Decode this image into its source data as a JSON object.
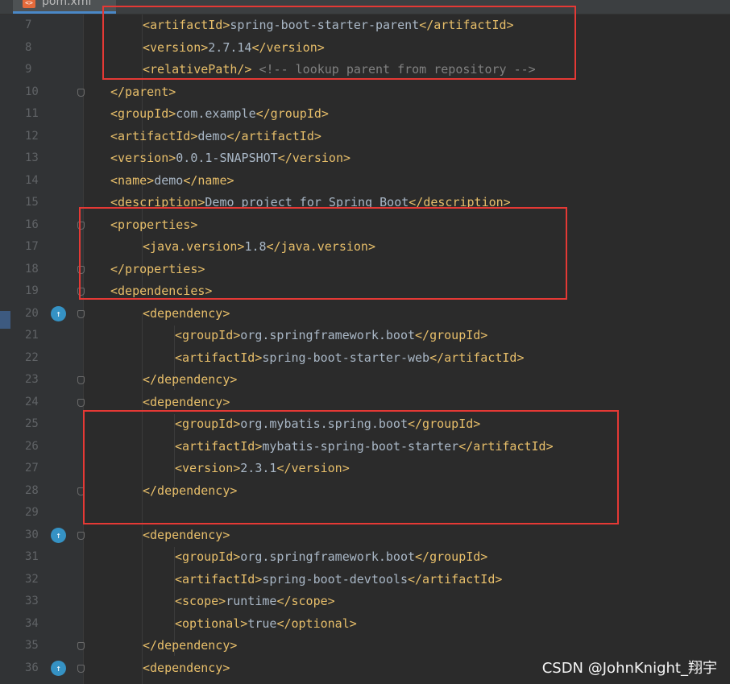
{
  "tab": {
    "filename": "pom.xml",
    "icon": "xml-file-icon"
  },
  "watermark": "CSDN @JohnKnight_翔宇",
  "colors": {
    "tag": "#e8bf6a",
    "text": "#a9b7c6",
    "comment": "#808080",
    "highlight": "#e53935",
    "run_icon": "#3592c4"
  },
  "lines": [
    {
      "num": "7",
      "indent": 2,
      "parts": [
        [
          "tag",
          "<artifactId>"
        ],
        [
          "text",
          "spring-boot-starter-parent"
        ],
        [
          "tag",
          "</artifactId>"
        ]
      ]
    },
    {
      "num": "8",
      "indent": 2,
      "parts": [
        [
          "tag",
          "<version>"
        ],
        [
          "text",
          "2.7.14"
        ],
        [
          "tag",
          "</version>"
        ]
      ]
    },
    {
      "num": "9",
      "indent": 2,
      "parts": [
        [
          "tag",
          "<relativePath/>"
        ],
        [
          "text",
          " "
        ],
        [
          "comment",
          "<!-- lookup parent from repository -->"
        ]
      ]
    },
    {
      "num": "10",
      "indent": 1,
      "parts": [
        [
          "tag",
          "</parent>"
        ]
      ]
    },
    {
      "num": "11",
      "indent": 1,
      "parts": [
        [
          "tag",
          "<groupId>"
        ],
        [
          "text",
          "com.example"
        ],
        [
          "tag",
          "</groupId>"
        ]
      ]
    },
    {
      "num": "12",
      "indent": 1,
      "parts": [
        [
          "tag",
          "<artifactId>"
        ],
        [
          "text",
          "demo"
        ],
        [
          "tag",
          "</artifactId>"
        ]
      ]
    },
    {
      "num": "13",
      "indent": 1,
      "parts": [
        [
          "tag",
          "<version>"
        ],
        [
          "text",
          "0.0.1-SNAPSHOT"
        ],
        [
          "tag",
          "</version>"
        ]
      ]
    },
    {
      "num": "14",
      "indent": 1,
      "parts": [
        [
          "tag",
          "<name>"
        ],
        [
          "text",
          "demo"
        ],
        [
          "tag",
          "</name>"
        ]
      ]
    },
    {
      "num": "15",
      "indent": 1,
      "parts": [
        [
          "tag",
          "<description>"
        ],
        [
          "text",
          "Demo project for Spring Boot"
        ],
        [
          "tag",
          "</description>"
        ]
      ]
    },
    {
      "num": "16",
      "indent": 1,
      "parts": [
        [
          "tag",
          "<properties>"
        ]
      ]
    },
    {
      "num": "17",
      "indent": 2,
      "parts": [
        [
          "tag",
          "<java.version>"
        ],
        [
          "text",
          "1.8"
        ],
        [
          "tag",
          "</java.version>"
        ]
      ]
    },
    {
      "num": "18",
      "indent": 1,
      "parts": [
        [
          "tag",
          "</properties>"
        ]
      ]
    },
    {
      "num": "19",
      "indent": 1,
      "parts": [
        [
          "tag",
          "<dependencies>"
        ]
      ]
    },
    {
      "num": "20",
      "indent": 2,
      "parts": [
        [
          "tag",
          "<dependency>"
        ]
      ]
    },
    {
      "num": "21",
      "indent": 3,
      "parts": [
        [
          "tag",
          "<groupId>"
        ],
        [
          "text",
          "org.springframework.boot"
        ],
        [
          "tag",
          "</groupId>"
        ]
      ]
    },
    {
      "num": "22",
      "indent": 3,
      "parts": [
        [
          "tag",
          "<artifactId>"
        ],
        [
          "text",
          "spring-boot-starter-web"
        ],
        [
          "tag",
          "</artifactId>"
        ]
      ]
    },
    {
      "num": "23",
      "indent": 2,
      "parts": [
        [
          "tag",
          "</dependency>"
        ]
      ]
    },
    {
      "num": "24",
      "indent": 2,
      "parts": [
        [
          "tag",
          "<dependency>"
        ]
      ]
    },
    {
      "num": "25",
      "indent": 3,
      "parts": [
        [
          "tag",
          "<groupId>"
        ],
        [
          "text",
          "org.mybatis.spring.boot"
        ],
        [
          "tag",
          "</groupId>"
        ]
      ]
    },
    {
      "num": "26",
      "indent": 3,
      "parts": [
        [
          "tag",
          "<artifactId>"
        ],
        [
          "text",
          "mybatis-spring-boot-starter"
        ],
        [
          "tag",
          "</artifactId>"
        ]
      ]
    },
    {
      "num": "27",
      "indent": 3,
      "parts": [
        [
          "tag",
          "<version>"
        ],
        [
          "text",
          "2.3.1"
        ],
        [
          "tag",
          "</version>"
        ]
      ]
    },
    {
      "num": "28",
      "indent": 2,
      "parts": [
        [
          "tag",
          "</dependency>"
        ]
      ]
    },
    {
      "num": "29",
      "indent": 0,
      "parts": []
    },
    {
      "num": "30",
      "indent": 2,
      "parts": [
        [
          "tag",
          "<dependency>"
        ]
      ]
    },
    {
      "num": "31",
      "indent": 3,
      "parts": [
        [
          "tag",
          "<groupId>"
        ],
        [
          "text",
          "org.springframework.boot"
        ],
        [
          "tag",
          "</groupId>"
        ]
      ]
    },
    {
      "num": "32",
      "indent": 3,
      "parts": [
        [
          "tag",
          "<artifactId>"
        ],
        [
          "text",
          "spring-boot-devtools"
        ],
        [
          "tag",
          "</artifactId>"
        ]
      ]
    },
    {
      "num": "33",
      "indent": 3,
      "parts": [
        [
          "tag",
          "<scope>"
        ],
        [
          "text",
          "runtime"
        ],
        [
          "tag",
          "</scope>"
        ]
      ]
    },
    {
      "num": "34",
      "indent": 3,
      "parts": [
        [
          "tag",
          "<optional>"
        ],
        [
          "text",
          "true"
        ],
        [
          "tag",
          "</optional>"
        ]
      ]
    },
    {
      "num": "35",
      "indent": 2,
      "parts": [
        [
          "tag",
          "</dependency>"
        ]
      ]
    },
    {
      "num": "36",
      "indent": 2,
      "parts": [
        [
          "tag",
          "<dependency>"
        ]
      ]
    }
  ],
  "fold_lines": [
    "10",
    "16",
    "18",
    "19",
    "20",
    "23",
    "24",
    "28",
    "30",
    "35",
    "36"
  ],
  "run_icon_lines": [
    "20",
    "30",
    "36"
  ]
}
